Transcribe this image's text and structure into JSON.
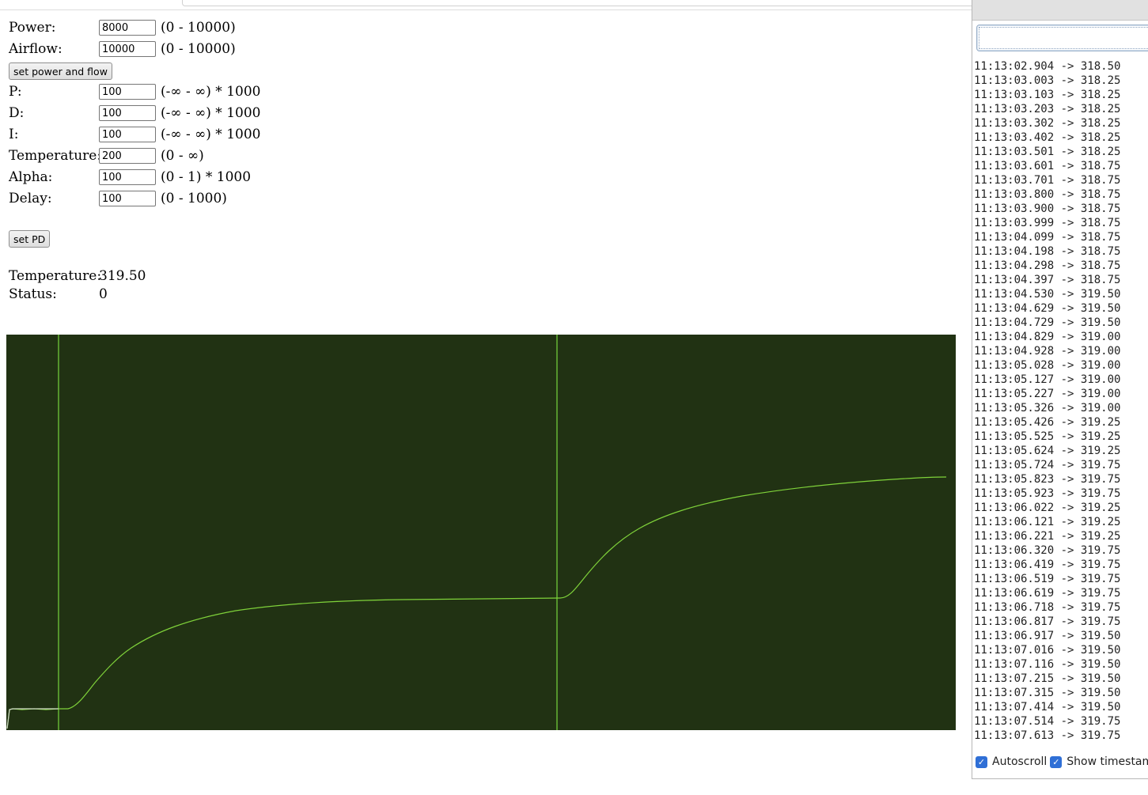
{
  "form": {
    "rows": [
      {
        "label": "Power:",
        "value": "8000",
        "range": "(0 - 10000)"
      },
      {
        "label": "Airflow:",
        "value": "10000",
        "range": "(0 - 10000)"
      },
      {
        "label": "P:",
        "value": "100",
        "range": "(-∞ - ∞) * 1000"
      },
      {
        "label": "D:",
        "value": "100",
        "range": "(-∞ - ∞) * 1000"
      },
      {
        "label": "I:",
        "value": "100",
        "range": "(-∞ - ∞) * 1000"
      },
      {
        "label": "Temperature:",
        "value": "200",
        "range": "(0 - ∞)"
      },
      {
        "label": "Alpha:",
        "value": "100",
        "range": "(0 - 1) * 1000"
      },
      {
        "label": "Delay:",
        "value": "100",
        "range": "(0 - 1000)"
      }
    ],
    "set_power_flow_label": "set power and flow",
    "set_pd_label": "set PD"
  },
  "status": {
    "temperature_label": "Temperature:",
    "temperature_value": "319.50",
    "status_label": "Status:",
    "status_value": "0"
  },
  "colors": {
    "plot_background": "#213213",
    "plot_line": "#7fd23a",
    "marker_line": "#6fc93a",
    "baseline": "#cfd8c8",
    "checkbox": "#2f6fd6"
  },
  "serial_monitor": {
    "input_value": "",
    "log": [
      "11:13:02.904 -> 318.50",
      "11:13:03.003 -> 318.25",
      "11:13:03.103 -> 318.25",
      "11:13:03.203 -> 318.25",
      "11:13:03.302 -> 318.25",
      "11:13:03.402 -> 318.25",
      "11:13:03.501 -> 318.25",
      "11:13:03.601 -> 318.75",
      "11:13:03.701 -> 318.75",
      "11:13:03.800 -> 318.75",
      "11:13:03.900 -> 318.75",
      "11:13:03.999 -> 318.75",
      "11:13:04.099 -> 318.75",
      "11:13:04.198 -> 318.75",
      "11:13:04.298 -> 318.75",
      "11:13:04.397 -> 318.75",
      "11:13:04.530 -> 319.50",
      "11:13:04.629 -> 319.50",
      "11:13:04.729 -> 319.50",
      "11:13:04.829 -> 319.00",
      "11:13:04.928 -> 319.00",
      "11:13:05.028 -> 319.00",
      "11:13:05.127 -> 319.00",
      "11:13:05.227 -> 319.00",
      "11:13:05.326 -> 319.00",
      "11:13:05.426 -> 319.25",
      "11:13:05.525 -> 319.25",
      "11:13:05.624 -> 319.25",
      "11:13:05.724 -> 319.75",
      "11:13:05.823 -> 319.75",
      "11:13:05.923 -> 319.75",
      "11:13:06.022 -> 319.25",
      "11:13:06.121 -> 319.25",
      "11:13:06.221 -> 319.25",
      "11:13:06.320 -> 319.75",
      "11:13:06.419 -> 319.75",
      "11:13:06.519 -> 319.75",
      "11:13:06.619 -> 319.75",
      "11:13:06.718 -> 319.75",
      "11:13:06.817 -> 319.75",
      "11:13:06.917 -> 319.50",
      "11:13:07.016 -> 319.50",
      "11:13:07.116 -> 319.50",
      "11:13:07.215 -> 319.50",
      "11:13:07.315 -> 319.50",
      "11:13:07.414 -> 319.50",
      "11:13:07.514 -> 319.75",
      "11:13:07.613 -> 319.75"
    ],
    "autoscroll_label": "Autoscroll",
    "show_timestamp_label": "Show timestam"
  }
}
